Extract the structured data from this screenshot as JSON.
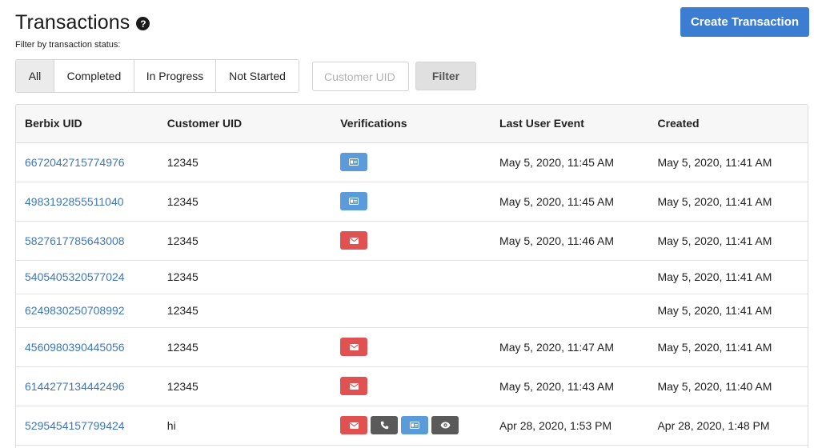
{
  "header": {
    "title": "Transactions",
    "help_icon": "?",
    "create_button": "Create Transaction"
  },
  "filter": {
    "label": "Filter by transaction status:",
    "statuses": [
      "All",
      "Completed",
      "In Progress",
      "Not Started"
    ],
    "active_status": "All",
    "uid_placeholder": "Customer UID",
    "uid_value": "",
    "filter_button": "Filter"
  },
  "table": {
    "columns": [
      "Berbix UID",
      "Customer UID",
      "Verifications",
      "Last User Event",
      "Created"
    ],
    "rows": [
      {
        "berbix_uid": "6672042715774976",
        "customer_uid": "12345",
        "verifications": [
          "id-card"
        ],
        "last_event": "May 5, 2020, 11:45 AM",
        "created": "May 5, 2020, 11:41 AM"
      },
      {
        "berbix_uid": "4983192855511040",
        "customer_uid": "12345",
        "verifications": [
          "id-card"
        ],
        "last_event": "May 5, 2020, 11:45 AM",
        "created": "May 5, 2020, 11:41 AM"
      },
      {
        "berbix_uid": "5827617785643008",
        "customer_uid": "12345",
        "verifications": [
          "email"
        ],
        "last_event": "May 5, 2020, 11:46 AM",
        "created": "May 5, 2020, 11:41 AM"
      },
      {
        "berbix_uid": "5405405320577024",
        "customer_uid": "12345",
        "verifications": [],
        "last_event": "",
        "created": "May 5, 2020, 11:41 AM"
      },
      {
        "berbix_uid": "6249830250708992",
        "customer_uid": "12345",
        "verifications": [],
        "last_event": "",
        "created": "May 5, 2020, 11:41 AM"
      },
      {
        "berbix_uid": "4560980390445056",
        "customer_uid": "12345",
        "verifications": [
          "email"
        ],
        "last_event": "May 5, 2020, 11:47 AM",
        "created": "May 5, 2020, 11:41 AM"
      },
      {
        "berbix_uid": "6144277134442496",
        "customer_uid": "12345",
        "verifications": [
          "email"
        ],
        "last_event": "May 5, 2020, 11:43 AM",
        "created": "May 5, 2020, 11:40 AM"
      },
      {
        "berbix_uid": "5295454157799424",
        "customer_uid": "hi",
        "verifications": [
          "email",
          "phone",
          "id-card",
          "eye"
        ],
        "last_event": "Apr 28, 2020, 1:53 PM",
        "created": "Apr 28, 2020, 1:48 PM"
      }
    ]
  },
  "colors": {
    "primary": "#3b7dd1",
    "link": "#3d76b8",
    "id_badge": "#5b9bd9",
    "email_badge": "#e05252",
    "dark_badge": "#5a5a5a"
  }
}
